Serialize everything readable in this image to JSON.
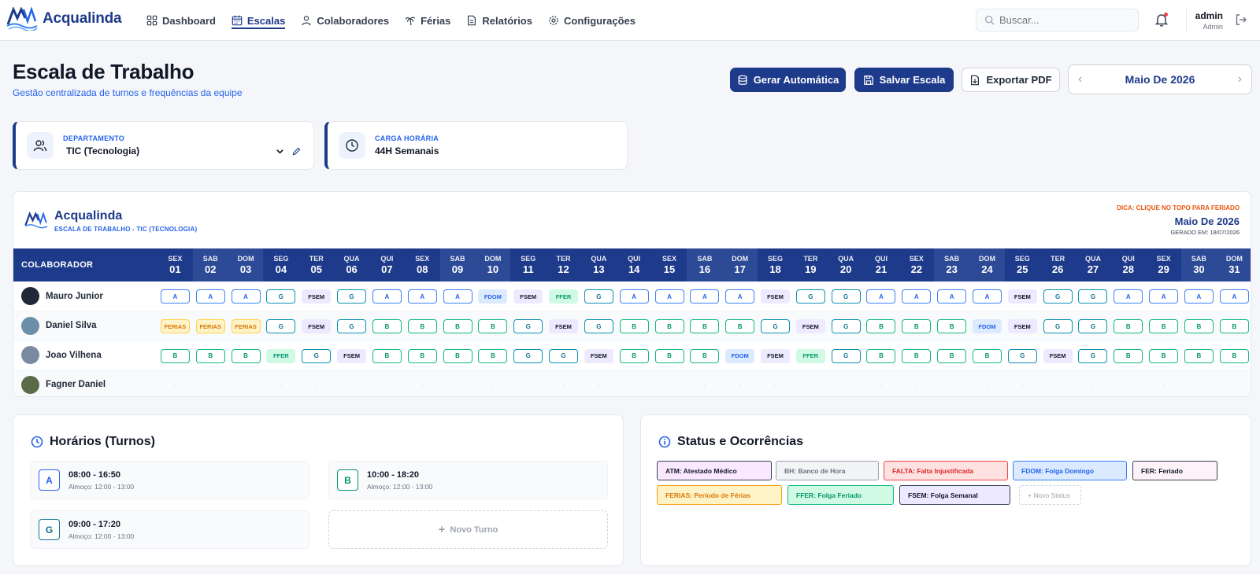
{
  "app": {
    "name": "Acqualinda"
  },
  "nav": [
    {
      "label": "Dashboard",
      "icon": "grid-icon",
      "active": false
    },
    {
      "label": "Escalas",
      "icon": "calendar-icon",
      "active": true
    },
    {
      "label": "Colaboradores",
      "icon": "user-icon",
      "active": false
    },
    {
      "label": "Férias",
      "icon": "palm-tree-icon",
      "active": false
    },
    {
      "label": "Relatórios",
      "icon": "file-text-icon",
      "active": false
    },
    {
      "label": "Configurações",
      "icon": "gear-icon",
      "active": false
    }
  ],
  "search": {
    "placeholder": "Buscar..."
  },
  "user": {
    "name": "admin",
    "role": "Admin"
  },
  "page": {
    "title": "Escala de Trabalho",
    "subtitle": "Gestão centralizada de turnos e frequências da equipe"
  },
  "actions": {
    "generate": "Gerar Automática",
    "save": "Salvar Escala",
    "export": "Exportar PDF",
    "month": "Maio De 2026"
  },
  "filters": {
    "department_label": "DEPARTAMENTO",
    "department_value": "TIC (Tecnologia)",
    "hours_label": "CARGA HORÁRIA",
    "hours_value": "44H Semanais"
  },
  "schedule": {
    "company": "Acqualinda",
    "subtitle": "ESCALA DE TRABALHO - TIC (TECNOLOGIA)",
    "tip": "DICA: CLIQUE NO TOPO PARA FERIADO",
    "month": "Maio De 2026",
    "generated": "GERADO EM: 18/07/2026",
    "column_header": "COLABORADOR",
    "days": [
      {
        "d": "SEX",
        "n": "01"
      },
      {
        "d": "SAB",
        "n": "02"
      },
      {
        "d": "DOM",
        "n": "03"
      },
      {
        "d": "SEG",
        "n": "04"
      },
      {
        "d": "TER",
        "n": "05"
      },
      {
        "d": "QUA",
        "n": "06"
      },
      {
        "d": "QUI",
        "n": "07"
      },
      {
        "d": "SEX",
        "n": "08"
      },
      {
        "d": "SAB",
        "n": "09"
      },
      {
        "d": "DOM",
        "n": "10"
      },
      {
        "d": "SEG",
        "n": "11"
      },
      {
        "d": "TER",
        "n": "12"
      },
      {
        "d": "QUA",
        "n": "13"
      },
      {
        "d": "QUI",
        "n": "14"
      },
      {
        "d": "SEX",
        "n": "15"
      },
      {
        "d": "SAB",
        "n": "16"
      },
      {
        "d": "DOM",
        "n": "17"
      },
      {
        "d": "SEG",
        "n": "18"
      },
      {
        "d": "TER",
        "n": "19"
      },
      {
        "d": "QUA",
        "n": "20"
      },
      {
        "d": "QUI",
        "n": "21"
      },
      {
        "d": "SEX",
        "n": "22"
      },
      {
        "d": "SAB",
        "n": "23"
      },
      {
        "d": "DOM",
        "n": "24"
      },
      {
        "d": "SEG",
        "n": "25"
      },
      {
        "d": "TER",
        "n": "26"
      },
      {
        "d": "QUA",
        "n": "27"
      },
      {
        "d": "QUI",
        "n": "28"
      },
      {
        "d": "SEX",
        "n": "29"
      },
      {
        "d": "SAB",
        "n": "30"
      },
      {
        "d": "DOM",
        "n": "31"
      }
    ],
    "employees": [
      {
        "name": "Mauro Junior",
        "cells": [
          "A",
          "A",
          "A",
          "G",
          "FSEM",
          "G",
          "A",
          "A",
          "A",
          "FDOM",
          "FSEM",
          "FFER",
          "G",
          "A",
          "A",
          "A",
          "A",
          "FSEM",
          "G",
          "G",
          "A",
          "A",
          "A",
          "A",
          "FSEM",
          "G",
          "G",
          "A",
          "A",
          "A",
          "A"
        ]
      },
      {
        "name": "Daniel Silva",
        "cells": [
          "FERIAS",
          "FERIAS",
          "FERIAS",
          "G",
          "FSEM",
          "G",
          "B",
          "B",
          "B",
          "B",
          "G",
          "FSEM",
          "G",
          "B",
          "B",
          "B",
          "B",
          "G",
          "FSEM",
          "G",
          "B",
          "B",
          "B",
          "FDOM",
          "FSEM",
          "G",
          "G",
          "B",
          "B",
          "B",
          "B"
        ]
      },
      {
        "name": "Joao Vilhena",
        "cells": [
          "B",
          "B",
          "B",
          "FFER",
          "G",
          "FSEM",
          "B",
          "B",
          "B",
          "B",
          "G",
          "G",
          "FSEM",
          "B",
          "B",
          "B",
          "FDOM",
          "FSEM",
          "FFER",
          "G",
          "B",
          "B",
          "B",
          "B",
          "G",
          "FSEM",
          "G",
          "B",
          "B",
          "B",
          "B"
        ]
      },
      {
        "name": "Fagner Daniel",
        "cells": [
          "-",
          "-",
          "-",
          "-",
          "-",
          "-",
          "-",
          "-",
          "-",
          "-",
          "-",
          "-",
          "-",
          "-",
          "-",
          "-",
          "-",
          "-",
          "-",
          "-",
          "-",
          "-",
          "-",
          "-",
          "-",
          "-",
          "-",
          "-",
          "-",
          "-",
          "-"
        ]
      }
    ]
  },
  "shifts": {
    "title": "Horários (Turnos)",
    "items": [
      {
        "code": "A",
        "time": "08:00 - 16:50",
        "lunch": "Almoço: 12:00 - 13:00",
        "color": "#2563eb"
      },
      {
        "code": "B",
        "time": "10:00 - 18:20",
        "lunch": "Almoço: 12:00 - 13:00",
        "color": "#059669"
      },
      {
        "code": "G",
        "time": "09:00 - 17:20",
        "lunch": "Almoço: 12:00 - 13:00",
        "color": "#0e7490"
      }
    ],
    "new_label": "Novo Turno"
  },
  "statuses": {
    "title": "Status e Ocorrências",
    "items": [
      {
        "label": "ATM: Atestado Médico",
        "color": "#111827",
        "bg": "#fae8ff",
        "border": "#374151"
      },
      {
        "label": "BH: Banco de Hora",
        "color": "#6b7280",
        "bg": "#f3f4f6",
        "border": "#9ca3af"
      },
      {
        "label": "FALTA: Falta Injustificada",
        "color": "#dc2626",
        "bg": "#fee2e2",
        "border": "#ef4444"
      },
      {
        "label": "FDOM: Folga Domingo",
        "color": "#2563eb",
        "bg": "#dbeafe",
        "border": "#3b82f6"
      },
      {
        "label": "FER: Feriado",
        "color": "#111827",
        "bg": "#fdf2f8",
        "border": "#374151"
      },
      {
        "label": "FERIAS: Período de Férias",
        "color": "#d97706",
        "bg": "#fef3c7",
        "border": "#f59e0b"
      },
      {
        "label": "FFER: Folga Feriado",
        "color": "#059669",
        "bg": "#d1fae5",
        "border": "#10b981"
      },
      {
        "label": "FSEM: Folga Semanal",
        "color": "#111827",
        "bg": "#ede9fe",
        "border": "#374151"
      }
    ],
    "new_label": "+ Novo Status"
  }
}
